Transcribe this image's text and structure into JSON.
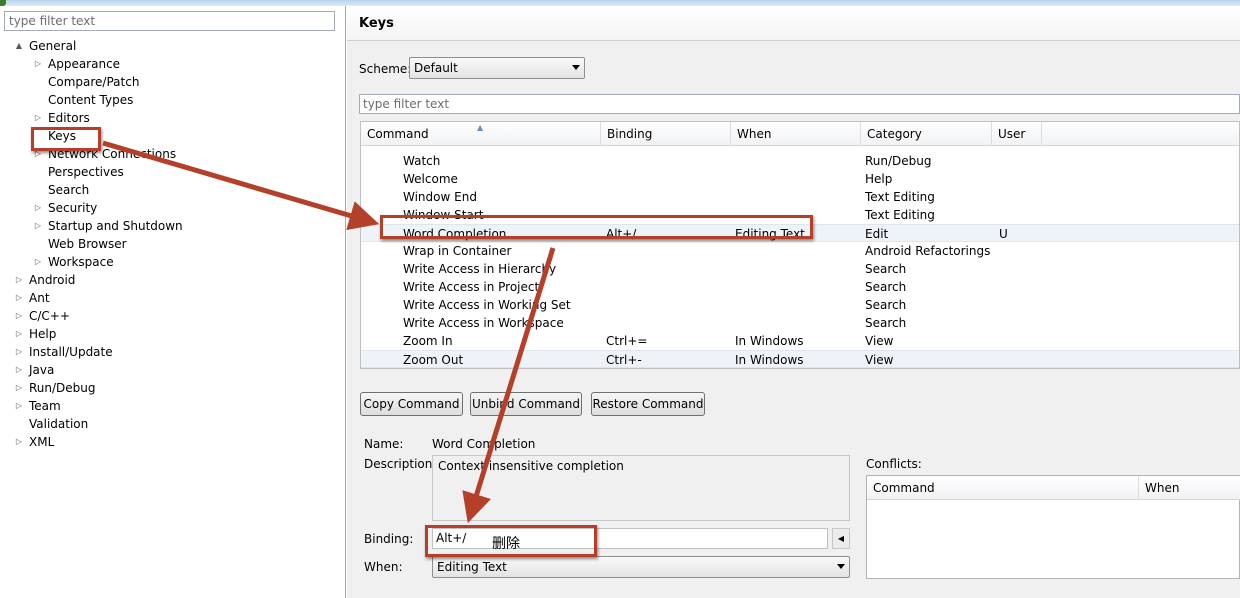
{
  "left_panel": {
    "filter_placeholder": "type filter text",
    "tree": [
      {
        "label": "General",
        "expanded": true,
        "level": 0,
        "twisty": "▲"
      },
      {
        "label": "Appearance",
        "level": 1,
        "twisty": "▷"
      },
      {
        "label": "Compare/Patch",
        "level": 1,
        "twisty": ""
      },
      {
        "label": "Content Types",
        "level": 1,
        "twisty": ""
      },
      {
        "label": "Editors",
        "level": 1,
        "twisty": "▷"
      },
      {
        "label": "Keys",
        "level": 1,
        "twisty": "",
        "highlighted": true
      },
      {
        "label": "Network Connections",
        "level": 1,
        "twisty": "▷"
      },
      {
        "label": "Perspectives",
        "level": 1,
        "twisty": ""
      },
      {
        "label": "Search",
        "level": 1,
        "twisty": ""
      },
      {
        "label": "Security",
        "level": 1,
        "twisty": "▷"
      },
      {
        "label": "Startup and Shutdown",
        "level": 1,
        "twisty": "▷"
      },
      {
        "label": "Web Browser",
        "level": 1,
        "twisty": ""
      },
      {
        "label": "Workspace",
        "level": 1,
        "twisty": "▷"
      },
      {
        "label": "Android",
        "level": 0,
        "twisty": "▷"
      },
      {
        "label": "Ant",
        "level": 0,
        "twisty": "▷"
      },
      {
        "label": "C/C++",
        "level": 0,
        "twisty": "▷"
      },
      {
        "label": "Help",
        "level": 0,
        "twisty": "▷"
      },
      {
        "label": "Install/Update",
        "level": 0,
        "twisty": "▷"
      },
      {
        "label": "Java",
        "level": 0,
        "twisty": "▷"
      },
      {
        "label": "Run/Debug",
        "level": 0,
        "twisty": "▷"
      },
      {
        "label": "Team",
        "level": 0,
        "twisty": "▷"
      },
      {
        "label": "Validation",
        "level": 0,
        "twisty": ""
      },
      {
        "label": "XML",
        "level": 0,
        "twisty": "▷"
      }
    ]
  },
  "keys_page": {
    "title": "Keys",
    "scheme_label": "Scheme:",
    "scheme_value": "Default",
    "filter_placeholder": "type filter text",
    "columns": [
      "Command",
      "Binding",
      "When",
      "Category",
      "User"
    ],
    "rows": [
      {
        "command": "Watch",
        "binding": "",
        "when": "",
        "category": "Run/Debug",
        "user": ""
      },
      {
        "command": "Welcome",
        "binding": "",
        "when": "",
        "category": "Help",
        "user": ""
      },
      {
        "command": "Window End",
        "binding": "",
        "when": "",
        "category": "Text Editing",
        "user": ""
      },
      {
        "command": "Window Start",
        "binding": "",
        "when": "",
        "category": "Text Editing",
        "user": ""
      },
      {
        "command": "Word Completion",
        "binding": "Alt+/",
        "when": "Editing Text",
        "category": "Edit",
        "user": "U"
      },
      {
        "command": "Wrap in Container",
        "binding": "",
        "when": "",
        "category": "Android Refactorings",
        "user": ""
      },
      {
        "command": "Write Access in Hierarchy",
        "binding": "",
        "when": "",
        "category": "Search",
        "user": ""
      },
      {
        "command": "Write Access in Project",
        "binding": "",
        "when": "",
        "category": "Search",
        "user": ""
      },
      {
        "command": "Write Access in Working Set",
        "binding": "",
        "when": "",
        "category": "Search",
        "user": ""
      },
      {
        "command": "Write Access in Workspace",
        "binding": "",
        "when": "",
        "category": "Search",
        "user": ""
      },
      {
        "command": "Zoom In",
        "binding": "Ctrl+=",
        "when": "In Windows",
        "category": "View",
        "user": ""
      },
      {
        "command": "Zoom Out",
        "binding": "Ctrl+-",
        "when": "In Windows",
        "category": "View",
        "user": ""
      }
    ],
    "buttons": {
      "copy": "Copy Command",
      "unbind": "Unbind Command",
      "restore": "Restore Command"
    },
    "details": {
      "name_label": "Name:",
      "name_value": "Word Completion",
      "description_label": "Description:",
      "description_value": "Context insensitive completion",
      "binding_label": "Binding:",
      "binding_value": "Alt+/",
      "binding_note": "删除",
      "when_label": "When:",
      "when_value": "Editing Text"
    },
    "conflicts": {
      "label": "Conflicts:",
      "columns": [
        "Command",
        "When"
      ]
    }
  },
  "annotation_color": "#b5402a"
}
